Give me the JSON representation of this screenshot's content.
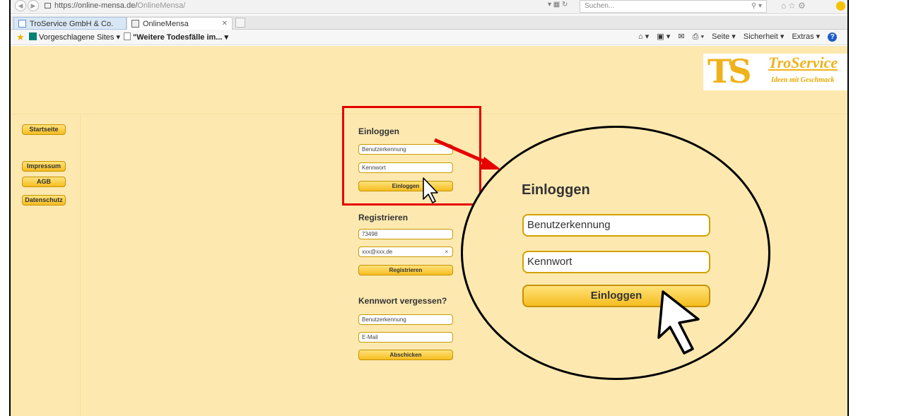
{
  "browser": {
    "url_host": "https://online-mensa.de/",
    "url_path": "OnlineMensa/",
    "search_placeholder": "Suchen...",
    "tabs": [
      {
        "label": "TroService GmbH & Co. KG - Ih..."
      },
      {
        "label": "OnlineMensa"
      }
    ],
    "favorites": {
      "suggested_sites": "Vorgeschlagene Sites ▾",
      "news_item": "\"Weitere Todesfälle im... ▾"
    },
    "command_bar": {
      "page": "Seite ▾",
      "security": "Sicherheit ▾",
      "extras": "Extras ▾"
    }
  },
  "logo": {
    "monogram": "TS",
    "name": "TroService",
    "slogan": "Ideen mit Geschmack"
  },
  "sidebar": {
    "items": [
      {
        "label": "Startseite"
      },
      {
        "label": "Impressum"
      },
      {
        "label": "AGB"
      },
      {
        "label": "Datenschutz"
      }
    ]
  },
  "login": {
    "title": "Einloggen",
    "username_placeholder": "Benutzerkennung",
    "password_placeholder": "Kennwort",
    "submit_label": "Einloggen"
  },
  "register": {
    "title": "Registrieren",
    "id_value": "73498",
    "email_value": "xxx@xxx.de",
    "submit_label": "Registrieren"
  },
  "forgot": {
    "title": "Kennwort vergessen?",
    "username_placeholder": "Benutzerkennung",
    "email_placeholder": "E-Mail",
    "submit_label": "Abschicken"
  },
  "zoom": {
    "title": "Einloggen",
    "username_placeholder": "Benutzerkennung",
    "password_placeholder": "Kennwort",
    "submit_label": "Einloggen"
  },
  "colors": {
    "page_background": "#fde9b0",
    "button_yellow": "#f6bd20",
    "highlight_red": "#e60000"
  }
}
